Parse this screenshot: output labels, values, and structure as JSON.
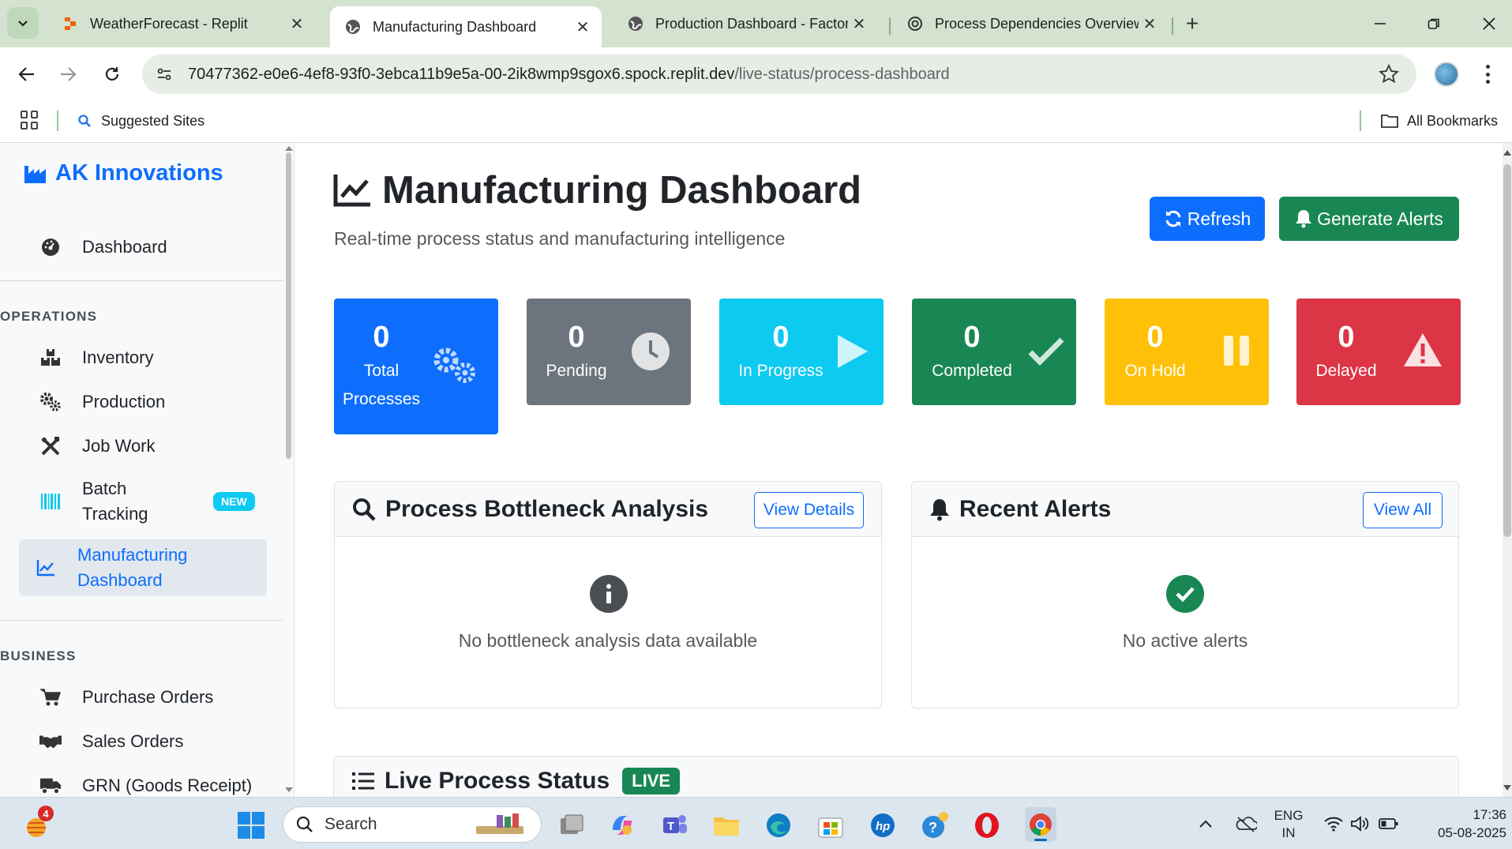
{
  "browser": {
    "tabs": [
      {
        "title": "WeatherForecast - Replit",
        "active": false
      },
      {
        "title": "Manufacturing Dashboard",
        "active": true
      },
      {
        "title": "Production Dashboard - Factory",
        "active": false
      },
      {
        "title": "Process Dependencies Overview",
        "active": false
      }
    ],
    "url_host": "70477362-e0e6-4ef8-93f0-3ebca11b9e5a-00-2ik8wmp9sgox6.spock.replit.dev",
    "url_path": "/live-status/process-dashboard",
    "bookmarks": {
      "suggested": "Suggested Sites",
      "all": "All Bookmarks"
    }
  },
  "sidebar": {
    "brand": "AK Innovations",
    "dashboard": "Dashboard",
    "section_operations": "OPERATIONS",
    "operations": [
      {
        "label": "Inventory",
        "icon": "boxes-icon"
      },
      {
        "label": "Production",
        "icon": "gears-icon"
      },
      {
        "label": "Job Work",
        "icon": "tools-icon"
      },
      {
        "label_line1": "Batch",
        "label_line2": "Tracking",
        "badge": "NEW",
        "icon": "barcode-icon"
      },
      {
        "label_line1": "Manufacturing",
        "label_line2": "Dashboard",
        "icon": "chart-line-icon",
        "active": true
      }
    ],
    "section_business": "BUSINESS",
    "business": [
      {
        "label": "Purchase Orders",
        "icon": "cart-icon"
      },
      {
        "label": "Sales Orders",
        "icon": "handshake-icon"
      },
      {
        "label": "GRN (Goods Receipt)",
        "icon": "truck-icon"
      }
    ]
  },
  "main": {
    "title": "Manufacturing Dashboard",
    "subtitle": "Real-time process status and manufacturing intelligence",
    "refresh_label": "Refresh",
    "alerts_label": "Generate Alerts",
    "stats": [
      {
        "value": "0",
        "label_line1": "Total",
        "label_line2": "Processes",
        "color": "#0d6efd",
        "icon": "gears-icon"
      },
      {
        "value": "0",
        "label": "Pending",
        "color": "#6c757d",
        "icon": "clock-icon"
      },
      {
        "value": "0",
        "label": "In Progress",
        "color": "#0dcaf0",
        "icon": "play-icon"
      },
      {
        "value": "0",
        "label": "Completed",
        "color": "#198754",
        "icon": "check-icon"
      },
      {
        "value": "0",
        "label": "On Hold",
        "color": "#ffc107",
        "icon": "pause-icon"
      },
      {
        "value": "0",
        "label": "Delayed",
        "color": "#dc3545",
        "icon": "warning-icon"
      }
    ],
    "bottleneck": {
      "title": "Process Bottleneck Analysis",
      "button": "View Details",
      "empty": "No bottleneck analysis data available"
    },
    "alerts": {
      "title": "Recent Alerts",
      "button": "View All",
      "empty": "No active alerts"
    },
    "live": {
      "title": "Live Process Status",
      "badge": "LIVE"
    }
  },
  "taskbar": {
    "search_placeholder": "Search",
    "notification_count": "4",
    "lang_line1": "ENG",
    "lang_line2": "IN",
    "time": "17:36",
    "date": "05-08-2025"
  }
}
